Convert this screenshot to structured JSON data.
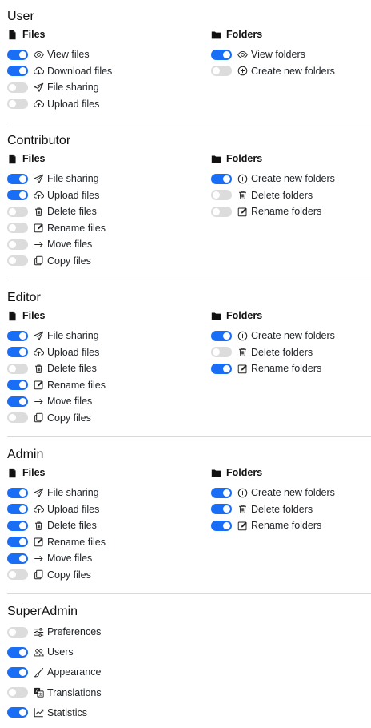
{
  "colors": {
    "toggle_on": "#1a6ef5",
    "toggle_off": "#dcdcdc"
  },
  "sections": [
    {
      "title": "User",
      "files": {
        "heading": "Files",
        "items": [
          {
            "label": "View files",
            "icon": "eye-icon",
            "enabled": true
          },
          {
            "label": "Download files",
            "icon": "cloud-download-icon",
            "enabled": true
          },
          {
            "label": "File sharing",
            "icon": "send-icon",
            "enabled": false
          },
          {
            "label": "Upload files",
            "icon": "cloud-upload-icon",
            "enabled": false
          }
        ]
      },
      "folders": {
        "heading": "Folders",
        "items": [
          {
            "label": "View folders",
            "icon": "eye-icon",
            "enabled": true
          },
          {
            "label": "Create new folders",
            "icon": "plus-circle-icon",
            "enabled": false
          }
        ]
      }
    },
    {
      "title": "Contributor",
      "files": {
        "heading": "Files",
        "items": [
          {
            "label": "File sharing",
            "icon": "send-icon",
            "enabled": true
          },
          {
            "label": "Upload files",
            "icon": "cloud-upload-icon",
            "enabled": true
          },
          {
            "label": "Delete files",
            "icon": "trash-icon",
            "enabled": false
          },
          {
            "label": "Rename files",
            "icon": "edit-icon",
            "enabled": false
          },
          {
            "label": "Move files",
            "icon": "arrow-right-icon",
            "enabled": false
          },
          {
            "label": "Copy files",
            "icon": "copy-icon",
            "enabled": false
          }
        ]
      },
      "folders": {
        "heading": "Folders",
        "items": [
          {
            "label": "Create new folders",
            "icon": "plus-circle-icon",
            "enabled": true
          },
          {
            "label": "Delete folders",
            "icon": "trash-icon",
            "enabled": false
          },
          {
            "label": "Rename folders",
            "icon": "edit-icon",
            "enabled": false
          }
        ]
      }
    },
    {
      "title": "Editor",
      "files": {
        "heading": "Files",
        "items": [
          {
            "label": "File sharing",
            "icon": "send-icon",
            "enabled": true
          },
          {
            "label": "Upload files",
            "icon": "cloud-upload-icon",
            "enabled": true
          },
          {
            "label": "Delete files",
            "icon": "trash-icon",
            "enabled": false
          },
          {
            "label": "Rename files",
            "icon": "edit-icon",
            "enabled": true
          },
          {
            "label": "Move files",
            "icon": "arrow-right-icon",
            "enabled": true
          },
          {
            "label": "Copy files",
            "icon": "copy-icon",
            "enabled": false
          }
        ]
      },
      "folders": {
        "heading": "Folders",
        "items": [
          {
            "label": "Create new folders",
            "icon": "plus-circle-icon",
            "enabled": true
          },
          {
            "label": "Delete folders",
            "icon": "trash-icon",
            "enabled": false
          },
          {
            "label": "Rename folders",
            "icon": "edit-icon",
            "enabled": true
          }
        ]
      }
    },
    {
      "title": "Admin",
      "files": {
        "heading": "Files",
        "items": [
          {
            "label": "File sharing",
            "icon": "send-icon",
            "enabled": true
          },
          {
            "label": "Upload files",
            "icon": "cloud-upload-icon",
            "enabled": true
          },
          {
            "label": "Delete files",
            "icon": "trash-icon",
            "enabled": true
          },
          {
            "label": "Rename files",
            "icon": "edit-icon",
            "enabled": true
          },
          {
            "label": "Move files",
            "icon": "arrow-right-icon",
            "enabled": true
          },
          {
            "label": "Copy files",
            "icon": "copy-icon",
            "enabled": false
          }
        ]
      },
      "folders": {
        "heading": "Folders",
        "items": [
          {
            "label": "Create new folders",
            "icon": "plus-circle-icon",
            "enabled": true
          },
          {
            "label": "Delete folders",
            "icon": "trash-icon",
            "enabled": true
          },
          {
            "label": "Rename folders",
            "icon": "edit-icon",
            "enabled": true
          }
        ]
      }
    }
  ],
  "superadmin": {
    "title": "SuperAdmin",
    "items": [
      {
        "label": "Preferences",
        "icon": "sliders-icon",
        "enabled": false
      },
      {
        "label": "Users",
        "icon": "users-icon",
        "enabled": true
      },
      {
        "label": "Appearance",
        "icon": "brush-icon",
        "enabled": true
      },
      {
        "label": "Translations",
        "icon": "translate-icon",
        "enabled": false
      },
      {
        "label": "Statistics",
        "icon": "chart-line-icon",
        "enabled": true
      }
    ]
  }
}
